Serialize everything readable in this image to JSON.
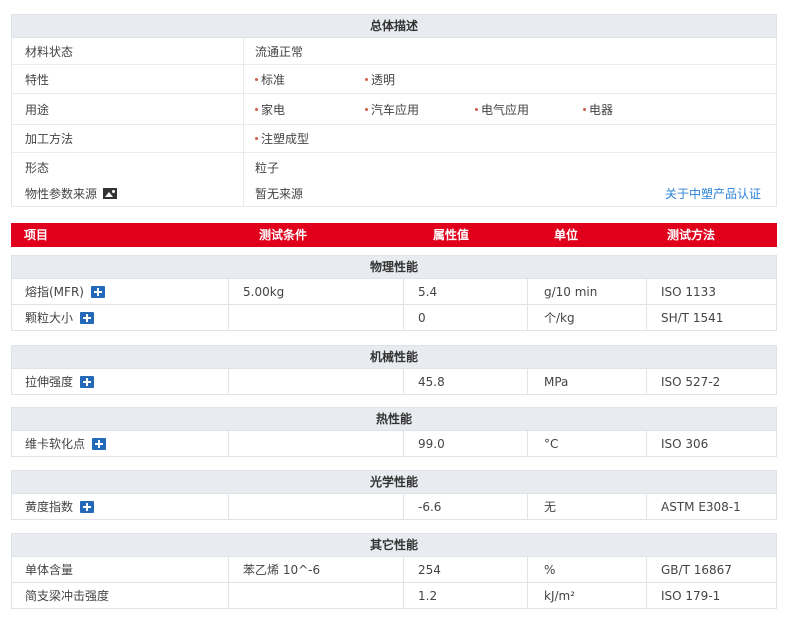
{
  "overview": {
    "title": "总体描述",
    "rows": [
      {
        "label": "材料状态",
        "values": [
          "流通正常"
        ]
      },
      {
        "label": "特性",
        "tags": [
          "标准",
          "透明"
        ]
      },
      {
        "label": "用途",
        "tags": [
          "家电",
          "汽车应用",
          "电气应用",
          "电器"
        ]
      },
      {
        "label": "加工方法",
        "tags": [
          "注塑成型"
        ]
      },
      {
        "label": "形态",
        "values": [
          "粒子"
        ]
      },
      {
        "label": "物性参数来源",
        "values": [
          "暂无来源"
        ],
        "link": "关于中塑产品认证"
      }
    ]
  },
  "header": {
    "item": "项目",
    "condition": "测试条件",
    "value": "属性值",
    "unit": "单位",
    "method": "测试方法"
  },
  "sections": [
    {
      "title": "物理性能",
      "rows": [
        {
          "name": "熔指(MFR)",
          "cond": "5.00kg",
          "value": "5.4",
          "unit": "g/10 min",
          "method": "ISO 1133",
          "icon": true
        },
        {
          "name": "颗粒大小",
          "cond": "",
          "value": "0",
          "unit": "个/kg",
          "method": "SH/T 1541",
          "icon": true
        }
      ]
    },
    {
      "title": "机械性能",
      "rows": [
        {
          "name": "拉伸强度",
          "cond": "",
          "value": "45.8",
          "unit": "MPa",
          "method": "ISO 527-2",
          "icon": true
        }
      ]
    },
    {
      "title": "热性能",
      "rows": [
        {
          "name": "维卡软化点",
          "cond": "",
          "value": "99.0",
          "unit": "°C",
          "method": "ISO 306",
          "icon": true
        }
      ]
    },
    {
      "title": "光学性能",
      "rows": [
        {
          "name": "黄度指数",
          "cond": "",
          "value": "-6.6",
          "unit": "无",
          "method": "ASTM E308-1",
          "icon": true
        }
      ]
    },
    {
      "title": "其它性能",
      "rows": [
        {
          "name": "单体含量",
          "cond": "苯乙烯 10^-6",
          "value": "254",
          "unit": "%",
          "method": "GB/T 16867",
          "icon": false
        },
        {
          "name": "简支梁冲击强度",
          "cond": "",
          "value": "1.2",
          "unit": "kJ/m²",
          "method": "ISO 179-1",
          "icon": false
        }
      ]
    }
  ],
  "colors": {
    "accent_red": "#e0001b",
    "link_blue": "#2b82d9",
    "icon_blue": "#2468b8"
  }
}
